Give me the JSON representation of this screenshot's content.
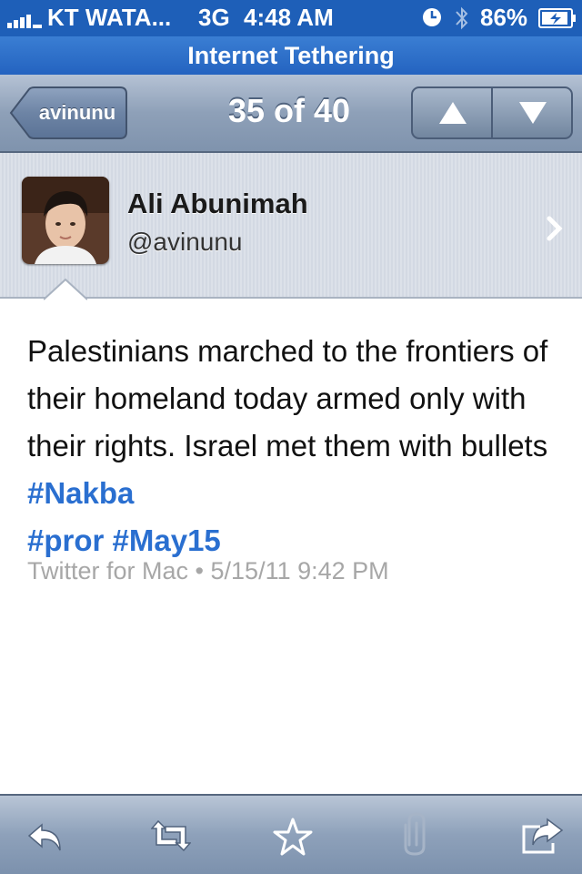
{
  "status_bar": {
    "carrier": "KT WATA...",
    "network": "3G",
    "time": "4:48 AM",
    "battery": "86%",
    "icons": [
      "signal-icon",
      "clock-icon",
      "bluetooth-icon",
      "battery-charging-icon"
    ],
    "color": "#1e5fb8"
  },
  "tether_bar": {
    "label": "Internet Tethering"
  },
  "nav": {
    "back_label": "avinunu",
    "title": "35 of 40",
    "prev_icon": "up-arrow-icon",
    "next_icon": "down-arrow-icon"
  },
  "profile": {
    "name": "Ali Abunimah",
    "handle": "@avinunu"
  },
  "tweet": {
    "text": "Palestinians marched to the frontiers of their homeland today armed only with their rights. Israel met them with bullets",
    "hashtags": [
      "#Nakba",
      "#pror",
      "#May15"
    ],
    "source": "Twitter for Mac",
    "separator": "•",
    "timestamp": "5/15/11 9:42 PM",
    "hashtag_color": "#2a6fd0"
  },
  "toolbar": {
    "items": [
      "reply-icon",
      "retweet-icon",
      "favorite-star-icon",
      "attachment-icon",
      "share-icon"
    ]
  }
}
